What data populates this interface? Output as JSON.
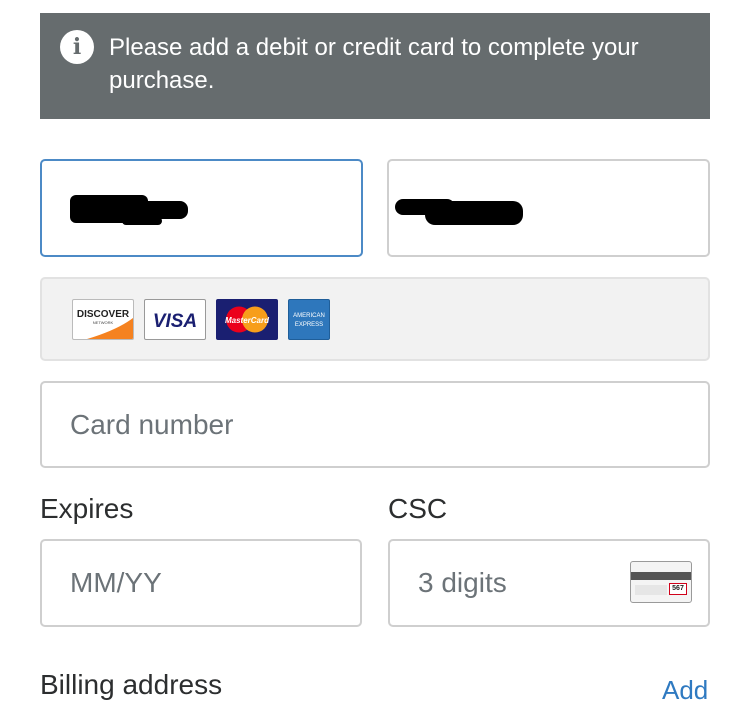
{
  "notice": {
    "icon": "info-icon",
    "text": "Please add a debit or credit card to complete your purchase."
  },
  "name_fields": {
    "first_name_value": "",
    "last_name_value": ""
  },
  "card_brands": {
    "discover": {
      "label": "DISCOVER",
      "sub": "NETWORK",
      "icon": "discover-logo",
      "color": "#f58220"
    },
    "visa": {
      "label": "VISA",
      "icon": "visa-logo",
      "color": "#1a1f71"
    },
    "mastercard": {
      "label": "MasterCard",
      "icon": "mastercard-logo",
      "color": "#1a1f71"
    },
    "amex": {
      "label_line1": "AMERICAN",
      "label_line2": "EXPRESS",
      "icon": "amex-logo",
      "color": "#2e77bc"
    }
  },
  "card_number": {
    "placeholder": "Card number",
    "value": ""
  },
  "expires": {
    "label": "Expires",
    "placeholder": "MM/YY",
    "value": ""
  },
  "csc": {
    "label": "CSC",
    "placeholder": "3 digits",
    "value": "",
    "icon": "card-back-csc-icon",
    "sample_code": "567"
  },
  "billing": {
    "label": "Billing address",
    "add_label": "Add"
  },
  "colors": {
    "accent": "#2f7ac1",
    "focus_border": "#4c8ac6",
    "notice_bg": "#666c6e"
  }
}
